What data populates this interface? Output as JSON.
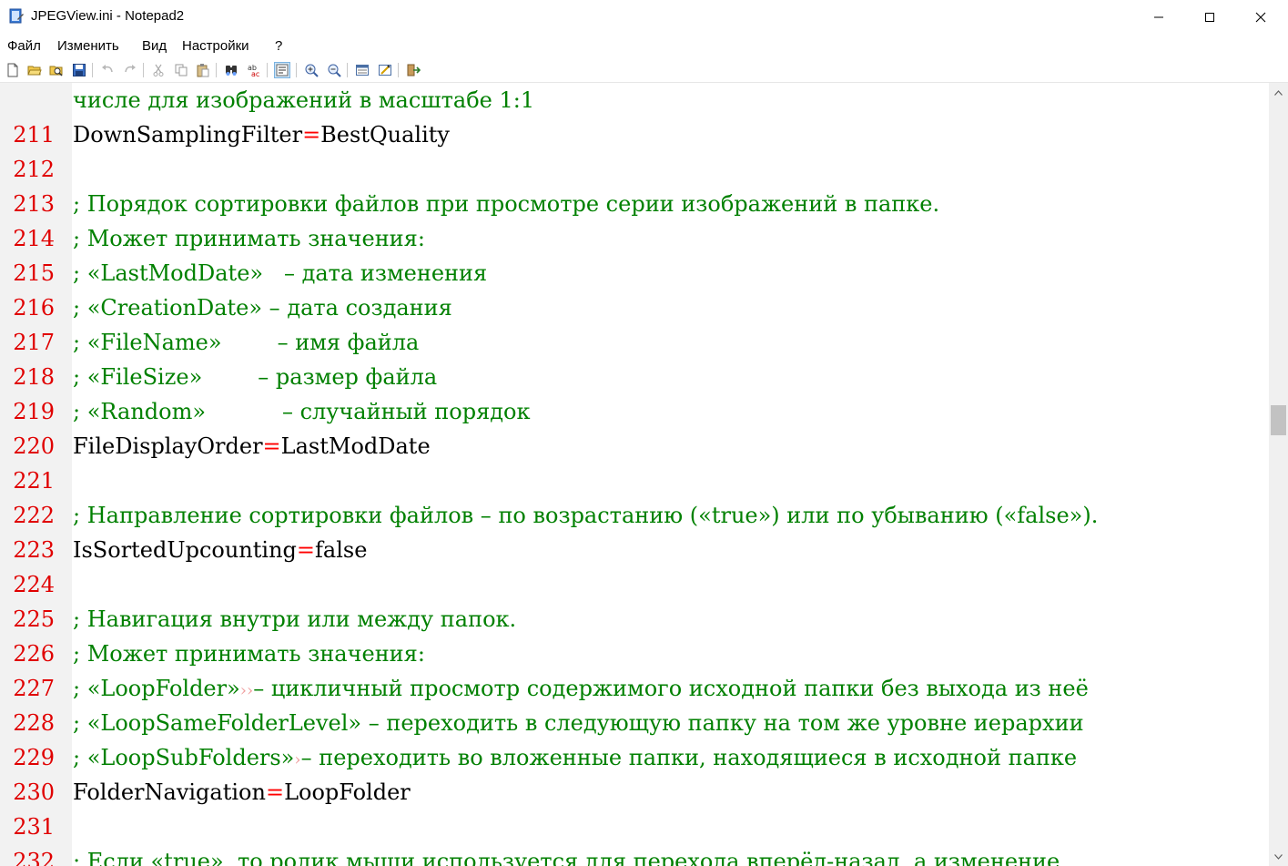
{
  "window": {
    "title": "JPEGView.ini - Notepad2"
  },
  "menu": [
    "Файл",
    "Изменить",
    "Вид",
    "Настройки",
    "?"
  ],
  "toolbar": {
    "icons": [
      "new-file-icon",
      "open-icon",
      "browse-icon",
      "save-icon",
      "undo-icon",
      "redo-icon",
      "cut-icon",
      "copy-icon",
      "paste-icon",
      "find-icon",
      "replace-icon",
      "word-wrap-icon",
      "zoom-in-icon",
      "zoom-out-icon",
      "scheme-icon",
      "customize-icon",
      "exit-icon"
    ]
  },
  "editor": {
    "lines": [
      {
        "num": "",
        "kind": "comment",
        "text": "числе для изображений в масштабе 1:1"
      },
      {
        "num": "211",
        "kind": "kv",
        "key": "DownSamplingFilter",
        "value": "BestQuality"
      },
      {
        "num": "212",
        "kind": "blank"
      },
      {
        "num": "213",
        "kind": "comment",
        "text": "; Порядок сортировки файлов при просмотре серии изображений в папке."
      },
      {
        "num": "214",
        "kind": "comment",
        "text": "; Может принимать значения:"
      },
      {
        "num": "215",
        "kind": "comment",
        "text": "; «LastModDate»   – дата изменения"
      },
      {
        "num": "216",
        "kind": "comment",
        "text": "; «CreationDate» – дата создания"
      },
      {
        "num": "217",
        "kind": "comment",
        "text": "; «FileName»        – имя файла"
      },
      {
        "num": "218",
        "kind": "comment",
        "text": "; «FileSize»        – размер файла"
      },
      {
        "num": "219",
        "kind": "comment",
        "text": "; «Random»           – случайный порядок"
      },
      {
        "num": "220",
        "kind": "kv",
        "key": "FileDisplayOrder",
        "value": "LastModDate"
      },
      {
        "num": "221",
        "kind": "blank"
      },
      {
        "num": "222",
        "kind": "comment",
        "text": "; Направление сортировки файлов – по возрастанию («true») или по убыванию («false»)."
      },
      {
        "num": "223",
        "kind": "kv",
        "key": "IsSortedUpcounting",
        "value": "false"
      },
      {
        "num": "224",
        "kind": "blank"
      },
      {
        "num": "225",
        "kind": "comment",
        "text": "; Навигация внутри или между папок."
      },
      {
        "num": "226",
        "kind": "comment",
        "text": "; Может принимать значения:"
      },
      {
        "num": "227",
        "kind": "comment",
        "text": "; «LoopFolder»",
        "tabs": 2,
        "rest": "– цикличный просмотр содержимого исходной папки без выхода из неё"
      },
      {
        "num": "228",
        "kind": "comment",
        "text": "; «LoopSameFolderLevel» – переходить в следующую папку на том же уровне иерархии"
      },
      {
        "num": "229",
        "kind": "comment",
        "text": "; «LoopSubFolders»",
        "tabs": 1,
        "rest": "– переходить во вложенные папки, находящиеся в исходной папке"
      },
      {
        "num": "230",
        "kind": "kv",
        "key": "FolderNavigation",
        "value": "LoopFolder"
      },
      {
        "num": "231",
        "kind": "blank"
      },
      {
        "num": "232",
        "kind": "comment",
        "text": "; Если «true», то ролик мыши используется для перехода вперёд-назад, а изменение"
      }
    ]
  }
}
